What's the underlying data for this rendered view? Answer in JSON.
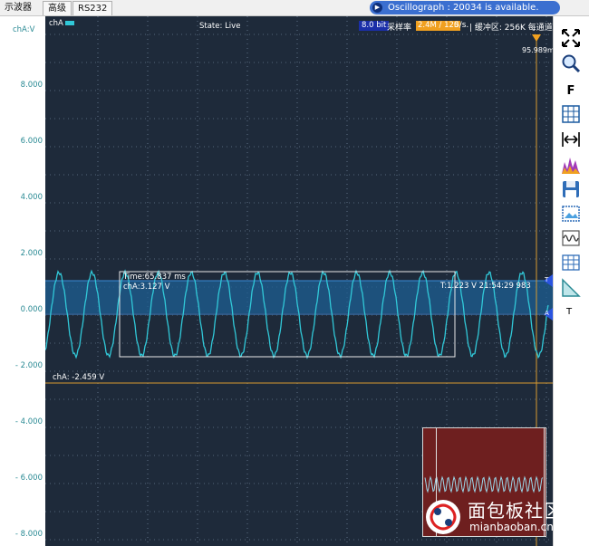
{
  "tabs": [
    "示波器",
    "高级",
    "RS232"
  ],
  "notice": "Oscillograph : 20034 is available.",
  "axis": {
    "unit": "chA:V",
    "ticks": [
      "8.000",
      "6.000",
      "4.000",
      "2.000",
      "0.000",
      "- 2.000",
      "- 4.000",
      "- 6.000",
      "- 8.000"
    ]
  },
  "plot": {
    "channel": "chA",
    "state": "State: Live",
    "bit": "8.0 bit",
    "rate_label": "采样率",
    "rate_value": "2.4M / 120",
    "rate_unit": "S/s.",
    "buffer": "| 缓冲区: 256K 每通道",
    "cursor_time": "95.989ms",
    "selection_time": "Time:65.837 ms",
    "selection_voltage": "chA:3.127 V",
    "trigger_readout": "T:1.223 V   21:54:29 983",
    "reference_line": "chA: -2.459 V",
    "trigger_marker": "T",
    "channel_marker": "A"
  },
  "toolbar": {
    "items": [
      "fit-screen",
      "zoom",
      "F",
      "grid",
      "measure-span",
      "histogram",
      "save",
      "screenshot",
      "waveform",
      "table",
      "ruler",
      "T"
    ],
    "letter_f": "F",
    "letter_t": "T"
  },
  "colors": {
    "plot_bg": "#1e2a3a",
    "trace": "#31c8d8",
    "trigger_band": "#1d5f93",
    "reference_line": "#d89a30",
    "selection_box": "#e8e8e8"
  },
  "watermark": {
    "cn": "面包板社区",
    "en": "mianbaoban.cn"
  }
}
